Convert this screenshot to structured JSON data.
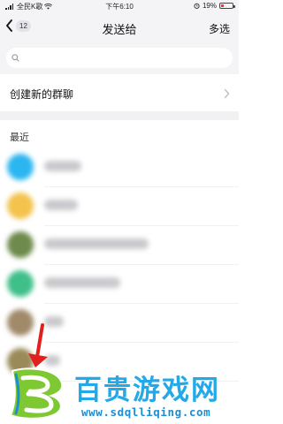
{
  "status_bar": {
    "carrier": "全民K歌",
    "time": "下午6:10",
    "battery": "19%"
  },
  "nav": {
    "back_count": "12",
    "title": "发送给",
    "multi_select": "多选"
  },
  "search": {
    "placeholder": ""
  },
  "create_group": {
    "label": "创建新的群聊"
  },
  "recent": {
    "header": "最近",
    "contacts": [
      {
        "avatar_color": "#2bb6f0",
        "name_blurred": true
      },
      {
        "avatar_color": "#f3c34c",
        "name_blurred": true
      },
      {
        "avatar_color": "#6e8a4c",
        "name_blurred": true
      },
      {
        "avatar_color": "#3fbf8a",
        "name_blurred": true
      },
      {
        "avatar_color": "#a08a6a",
        "name_blurred": true
      },
      {
        "avatar_color": "#9a8a5a",
        "name_blurred": true
      }
    ]
  },
  "watermark": {
    "title": "百贵游戏网",
    "url": "www.sdqlliqing.com"
  },
  "colors": {
    "nav_background": "#f4f4f6",
    "watermark_blue": "#23a8e8",
    "arrow_red": "#e0201c",
    "logo_green": "#7ec832"
  }
}
